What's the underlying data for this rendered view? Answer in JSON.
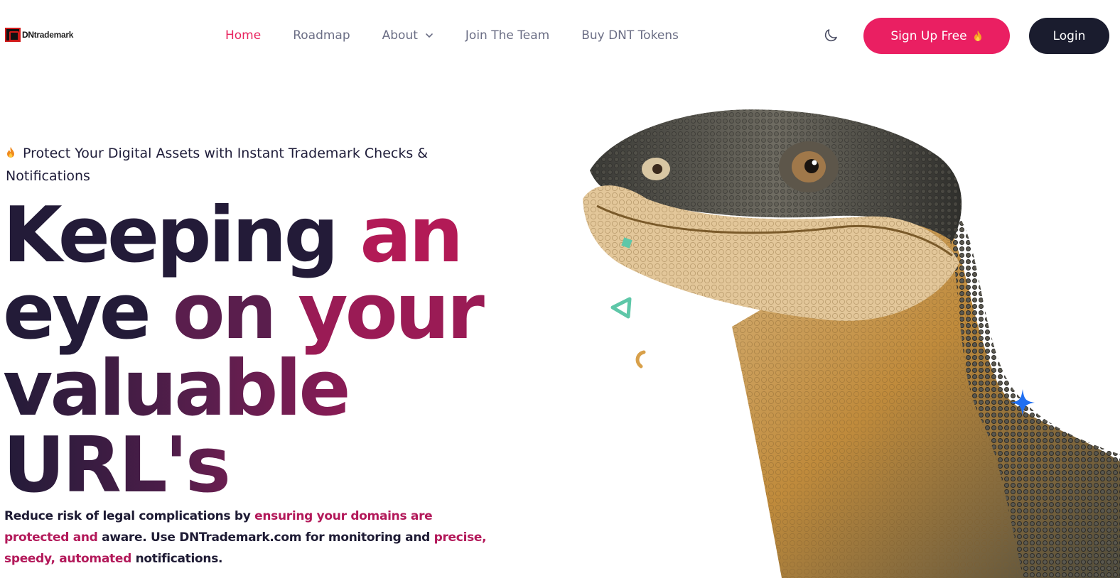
{
  "brand": {
    "logo_text": "DNtrademark",
    "logo_prefix": "DN",
    "logo_suffix": "trademark"
  },
  "nav": {
    "items": [
      {
        "label": "Home",
        "active": true
      },
      {
        "label": "Roadmap",
        "active": false
      },
      {
        "label": "About",
        "active": false,
        "has_dropdown": true
      },
      {
        "label": "Join The Team",
        "active": false
      },
      {
        "label": "Buy DNT Tokens",
        "active": false
      }
    ],
    "theme_toggle_icon": "moon-icon",
    "signup_label": "Sign Up Free",
    "login_label": "Login"
  },
  "hero": {
    "tagline": "Protect Your Digital Assets with Instant Trademark Checks & Notifications",
    "headline_line1_a": "Keeping ",
    "headline_line1_b": "an",
    "headline_line2_a": "eye ",
    "headline_line2_b": "on ",
    "headline_line2_c": "your",
    "headline_line3": "valuable",
    "headline_line4": "URL's",
    "lead_part1": "Reduce risk of legal complications by ",
    "lead_part2": "ensuring your domains are protected and",
    "lead_part3": " aware. Use DNTrademark.com for monitoring and ",
    "lead_part4": "precise, speedy, automated",
    "lead_part5": " notifications."
  },
  "colors": {
    "accent": "#ea1f62",
    "dark": "#1a1c2e",
    "nav_text": "#6b6e85",
    "headline_dark": "#231b38",
    "headline_mid": "#5a1e4d",
    "headline_accent": "#b21a56"
  },
  "icons": {
    "flame": "flame-icon",
    "chevron": "chevron-down-icon",
    "moon": "moon-icon",
    "sparkle": "sparkle-icon"
  }
}
